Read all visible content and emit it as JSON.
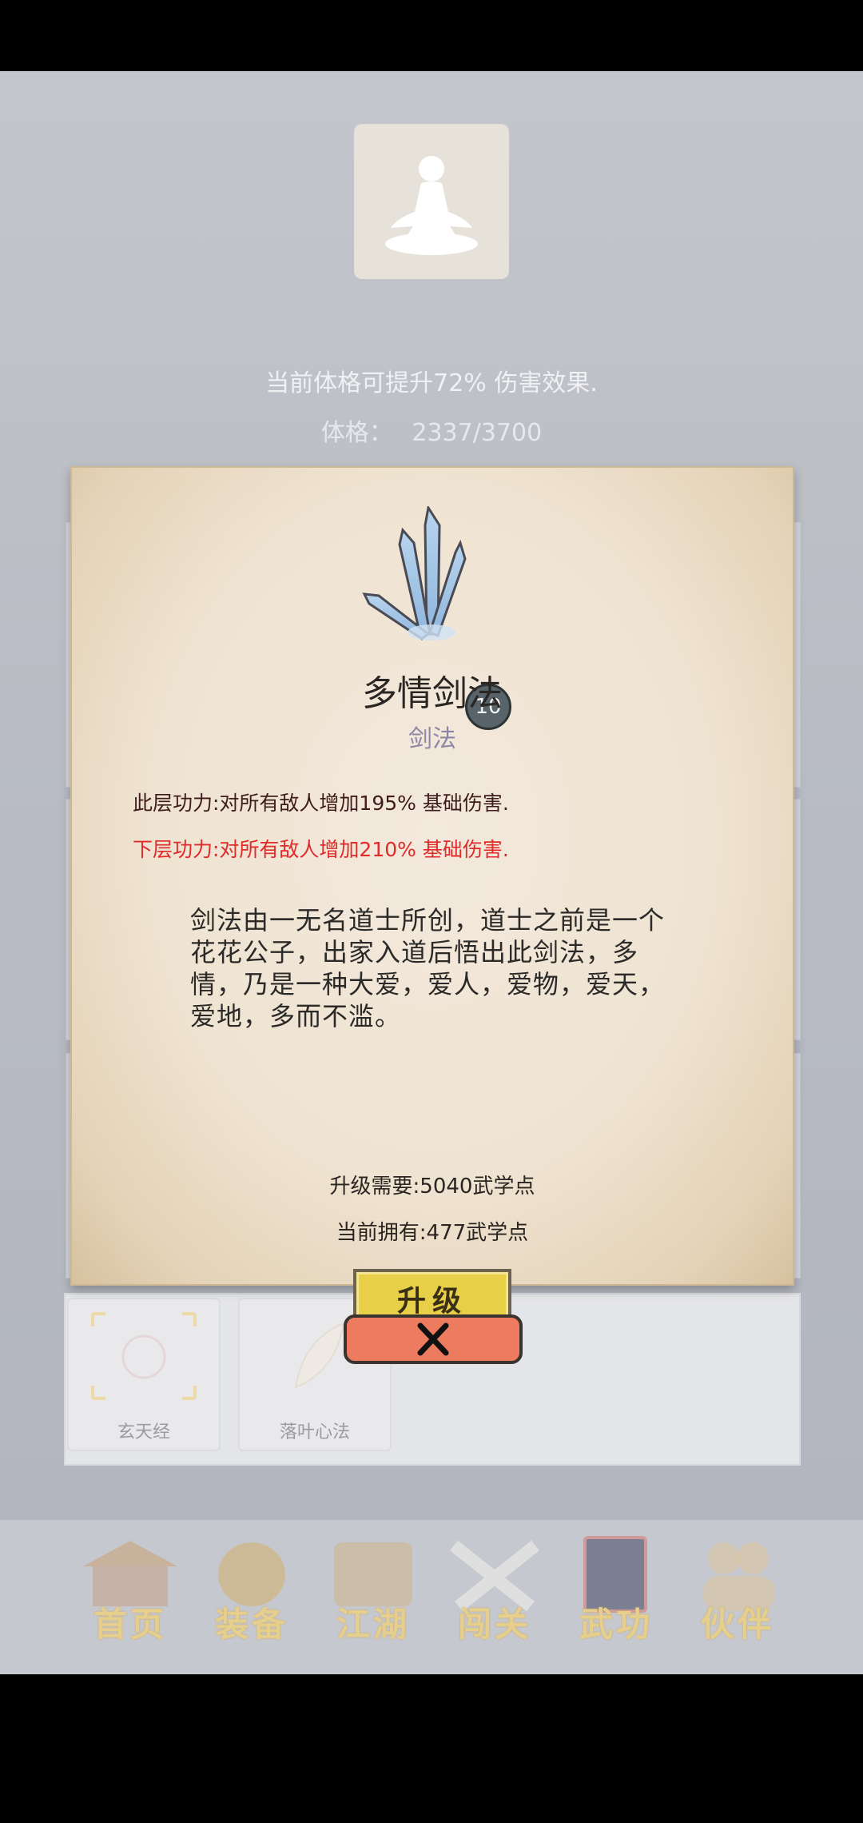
{
  "header": {
    "bonus_text": "当前体格可提升72% 伤害效果.",
    "physique_label": "体格：",
    "physique_value": "2337/3700"
  },
  "skill_popup": {
    "level": "10",
    "name": "多情剑法",
    "type": "剑法",
    "current_effect": "此层功力:对所有敌人增加195% 基础伤害.",
    "next_effect": "下层功力:对所有敌人增加210% 基础伤害.",
    "description": "剑法由一无名道士所创，道士之前是一个花花公子，出家入道后悟出此剑法，多情，乃是一种大爱，爱人，爱物，爱天，爱地，多而不滥。",
    "upgrade_cost": "升级需要:5040武学点",
    "points_owned": "当前拥有:477武学点",
    "upgrade_button": "升级"
  },
  "skill_list": [
    {
      "label": "玄天经"
    },
    {
      "label": "落叶心法"
    }
  ],
  "bottom_nav": [
    {
      "label": "首页",
      "icon": "temple-icon"
    },
    {
      "label": "装备",
      "icon": "armor-icon"
    },
    {
      "label": "江湖",
      "icon": "scroll-map-icon"
    },
    {
      "label": "闯关",
      "icon": "crossed-swords-icon"
    },
    {
      "label": "武功",
      "icon": "book-icon"
    },
    {
      "label": "伙伴",
      "icon": "partners-icon"
    }
  ],
  "colors": {
    "next_effect": "#e12a2a",
    "skill_type": "#8d86a6",
    "upgrade_button": "#e7cf47",
    "close_button": "#ec7b5f"
  }
}
